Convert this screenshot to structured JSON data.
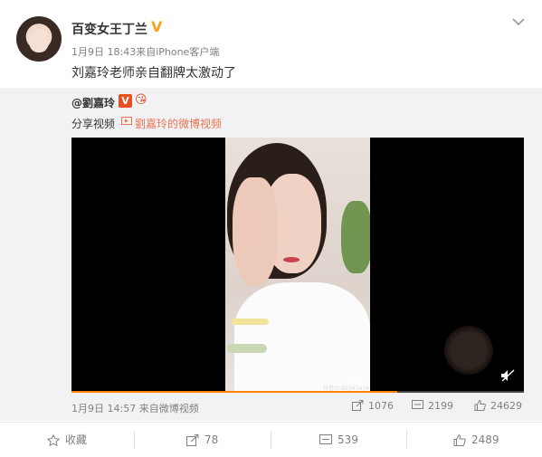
{
  "post": {
    "username": "百变女王丁兰",
    "verified_mark": "V",
    "meta": "1月9日 18:43来自iPhone客户端",
    "text": "刘嘉玲老师亲自翻牌太激动了"
  },
  "repost": {
    "orig_username": "@劉嘉玲",
    "orig_verified": "V",
    "orig_emoji": "😘",
    "share_label": "分享视频",
    "share_link": "劉嘉玲的微博视频"
  },
  "video": {
    "watermark": "♪ 抖音",
    "watermark_id": "抖音ID:92347434",
    "progress_fraction": 0.72,
    "meta": "1月9日 14:57 来自微博视频",
    "reposts": "1076",
    "comments": "2199",
    "likes": "24629"
  },
  "actions": {
    "favorite": "收藏",
    "repost": "78",
    "comment": "539",
    "like": "2489"
  },
  "colors": {
    "accent_orange": "#ff8200",
    "link_orange": "#eb7350",
    "verified_gold": "#f7a41f"
  }
}
